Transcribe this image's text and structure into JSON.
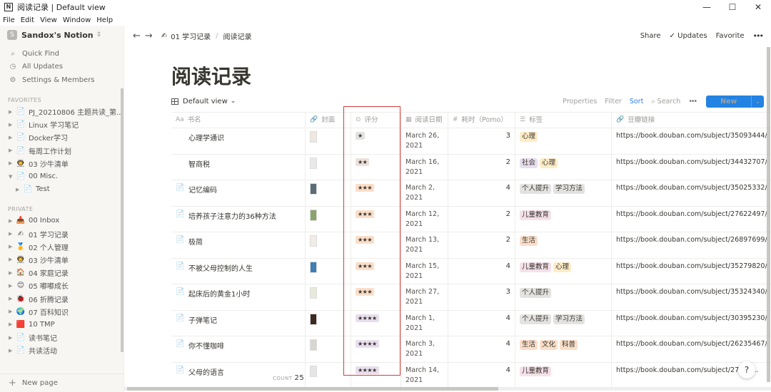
{
  "window": {
    "title": "阅读记录 | Default view",
    "app_icon": "N",
    "controls": [
      "—",
      "☐",
      "✕"
    ]
  },
  "menu": [
    "File",
    "Edit",
    "View",
    "Window",
    "Help"
  ],
  "sidebar": {
    "workspace_initial": "S",
    "workspace": "Sandox's Notion",
    "nav": [
      {
        "label": "Quick Find",
        "icon": "search-icon"
      },
      {
        "label": "All Updates",
        "icon": "clock-icon"
      },
      {
        "label": "Settings & Members",
        "icon": "gear-icon"
      }
    ],
    "favorites_label": "FAVORITES",
    "favorites": [
      {
        "label": "PJ_20210806 主题共读_第...",
        "icon": "📄",
        "expanded": false
      },
      {
        "label": "Linux 学习笔记",
        "icon": "📄",
        "expanded": false
      },
      {
        "label": "Docker学习",
        "icon": "📄",
        "expanded": false
      },
      {
        "label": "每周工作计划",
        "icon": "📄",
        "expanded": false
      },
      {
        "label": "03 沙牛清单",
        "icon": "👨‍🚀",
        "expanded": false
      },
      {
        "label": "00 Misc.",
        "icon": "📄",
        "expanded": true
      },
      {
        "label": "Test",
        "icon": "📄",
        "expanded": false,
        "sub": true
      }
    ],
    "private_label": "PRIVATE",
    "private": [
      {
        "label": "00 Inbox",
        "icon": "📥"
      },
      {
        "label": "01 学习记录",
        "icon": "✍"
      },
      {
        "label": "02 个人管理",
        "icon": "🥇"
      },
      {
        "label": "03 沙牛清单",
        "icon": "👨‍🚀"
      },
      {
        "label": "04 家庭记录",
        "icon": "🏠"
      },
      {
        "label": "05 嘟嘟成长",
        "icon": "😊"
      },
      {
        "label": "06 折腾记录",
        "icon": "🐞"
      },
      {
        "label": "07 百科知识",
        "icon": "🌍"
      },
      {
        "label": "10 TMP",
        "icon": "🟥"
      },
      {
        "label": "读书笔记",
        "icon": "📄"
      },
      {
        "label": "共读活动",
        "icon": "📄"
      }
    ],
    "new_page": "New page"
  },
  "topbar": {
    "back": "←",
    "forward": "→",
    "crumb_parent_icon": "✍",
    "crumb_parent": "01 学习记录",
    "crumb_sep": "/",
    "crumb_current": "阅读记录",
    "share": "Share",
    "updates": "Updates",
    "updates_icon": "✓",
    "favorite": "Favorite",
    "more": "•••"
  },
  "page": {
    "title": "阅读记录",
    "view_name": "Default view",
    "view_chevron": "⌄",
    "actions": {
      "properties": "Properties",
      "filter": "Filter",
      "sort": "Sort",
      "search": "Search",
      "more": "•••",
      "new": "New",
      "new_dd": "⌄"
    }
  },
  "table": {
    "headers": [
      {
        "label": "书名",
        "icon": "Aa"
      },
      {
        "label": "封面",
        "icon": "🔗"
      },
      {
        "label": "评分",
        "icon": "⊙"
      },
      {
        "label": "阅读日期",
        "icon": "▦"
      },
      {
        "label": "耗时（Pomo）",
        "icon": "#"
      },
      {
        "label": "标签",
        "icon": "☰"
      },
      {
        "label": "豆瓣链接",
        "icon": "🔗"
      }
    ],
    "rows": [
      {
        "name": "心理学通识",
        "icon": "",
        "cover_color": "#efe7e0",
        "stars": "★",
        "star_bg": "#e3e2e0",
        "date": "March 26, 2021",
        "pomo": "3",
        "tags": [
          {
            "t": "心理",
            "bg": "#fdecc8"
          }
        ],
        "link": "https://book.douban.com/subject/35093444/"
      },
      {
        "name": "智商税",
        "icon": "",
        "cover_color": "#e9e9e9",
        "stars": "★★",
        "star_bg": "#eee0da",
        "date": "March 16, 2021",
        "pomo": "2",
        "tags": [
          {
            "t": "社会",
            "bg": "#e8deee"
          },
          {
            "t": "心理",
            "bg": "#fdecc8"
          }
        ],
        "link": "https://book.douban.com/subject/34432707/"
      },
      {
        "name": "记忆编码",
        "icon": "📄",
        "cover_color": "#5b6b78",
        "stars": "★★★",
        "star_bg": "#fadec9",
        "date": "March 2, 2021",
        "pomo": "4",
        "tags": [
          {
            "t": "个人提升",
            "bg": "#e3e2e0"
          },
          {
            "t": "学习方法",
            "bg": "#e3e2e0"
          }
        ],
        "link": "https://book.douban.com/subject/35025332/"
      },
      {
        "name": "培养孩子注意力的36种方法",
        "icon": "📄",
        "cover_color": "#8aa36b",
        "stars": "★★★",
        "star_bg": "#fadec9",
        "date": "March 12, 2021",
        "pomo": "2",
        "tags": [
          {
            "t": "儿童教育",
            "bg": "#f5e0e9"
          }
        ],
        "link": "https://book.douban.com/subject/27622497/"
      },
      {
        "name": "极简",
        "icon": "📄",
        "cover_color": "#f1ede6",
        "stars": "★★★",
        "star_bg": "#fadec9",
        "date": "March 13, 2021",
        "pomo": "2",
        "tags": [
          {
            "t": "生活",
            "bg": "#fadec9"
          }
        ],
        "link": "https://book.douban.com/subject/26897699/"
      },
      {
        "name": "不被父母控制的人生",
        "icon": "📄",
        "cover_color": "#3f7fb5",
        "stars": "★★★",
        "star_bg": "#fadec9",
        "date": "March 15, 2021",
        "pomo": "4",
        "tags": [
          {
            "t": "儿童教育",
            "bg": "#f5e0e9"
          },
          {
            "t": "心理",
            "bg": "#fdecc8"
          }
        ],
        "link": "https://book.douban.com/subject/35279820/"
      },
      {
        "name": "起床后的黄金1小时",
        "icon": "📄",
        "cover_color": "#e7ead8",
        "stars": "★★★",
        "star_bg": "#fadec9",
        "date": "March 27, 2021",
        "pomo": "3",
        "tags": [
          {
            "t": "个人提升",
            "bg": "#e3e2e0"
          }
        ],
        "link": "https://book.douban.com/subject/35324340/"
      },
      {
        "name": "子弹笔记",
        "icon": "📄",
        "cover_color": "#3a2a22",
        "stars": "★★★★",
        "star_bg": "#e8deee",
        "date": "March 1, 2021",
        "pomo": "4",
        "tags": [
          {
            "t": "个人提升",
            "bg": "#e3e2e0"
          },
          {
            "t": "学习方法",
            "bg": "#e3e2e0"
          }
        ],
        "link": "https://book.douban.com/subject/30395230/"
      },
      {
        "name": "你不懂咖啡",
        "icon": "📄",
        "cover_color": "#d9d6cf",
        "stars": "★★★★",
        "star_bg": "#e8deee",
        "date": "March 3, 2021",
        "pomo": "4",
        "tags": [
          {
            "t": "生活",
            "bg": "#fadec9"
          },
          {
            "t": "文化",
            "bg": "#fadec9"
          },
          {
            "t": "科普",
            "bg": "#fadec9"
          }
        ],
        "link": "https://book.douban.com/subject/26235467/"
      },
      {
        "name": "父母的语言",
        "icon": "📄",
        "cover_color": "#e6e6e6",
        "stars": "★★★★",
        "star_bg": "#e8deee",
        "date": "March 14, 2021",
        "pomo": "4",
        "tags": [
          {
            "t": "儿童教育",
            "bg": "#f5e0e9"
          }
        ],
        "link": "https://book.douban.com/subject/27134..."
      }
    ],
    "count_label": "COUNT",
    "count": "25"
  },
  "help": "?"
}
